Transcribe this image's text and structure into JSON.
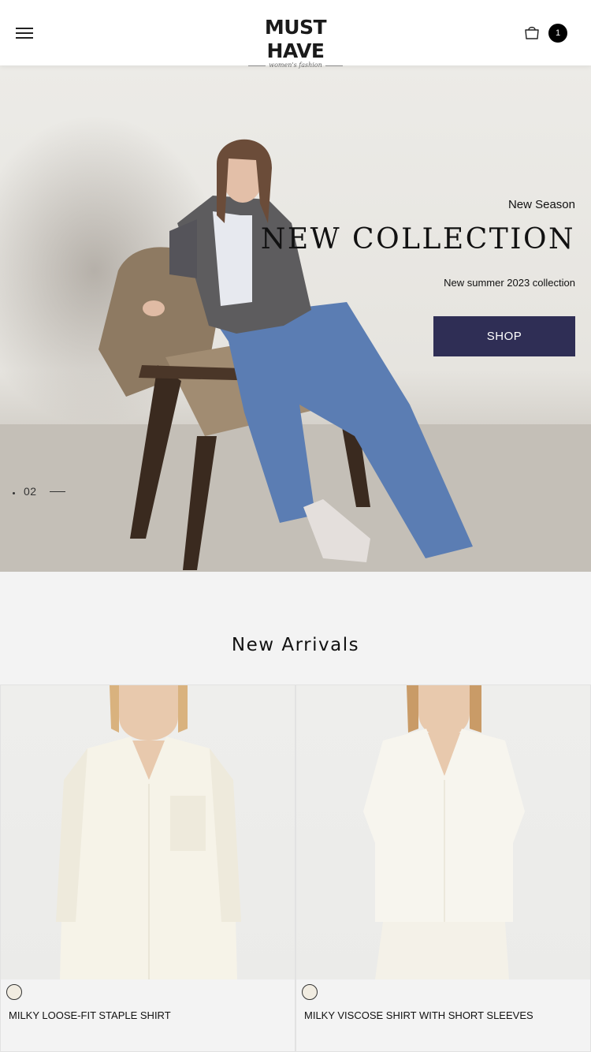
{
  "header": {
    "logo_text": "MUST HAVE",
    "logo_tagline": "women's fashion",
    "cart_count": "1"
  },
  "hero": {
    "eyebrow": "New Season",
    "headline": "NEW COLLECTION",
    "subline": "New summer 2023 collection",
    "cta_label": "SHOP",
    "slide_number": "02",
    "cta_color": "#2f2e55"
  },
  "arrivals": {
    "title": "New Arrivals",
    "products": [
      {
        "name": "MILKY LOOSE-FIT STAPLE SHIRT",
        "swatch_color": "#f1ece1"
      },
      {
        "name": "MILKY VISCOSE SHIRT WITH SHORT SLEEVES",
        "swatch_color": "#f1ece1"
      }
    ]
  }
}
